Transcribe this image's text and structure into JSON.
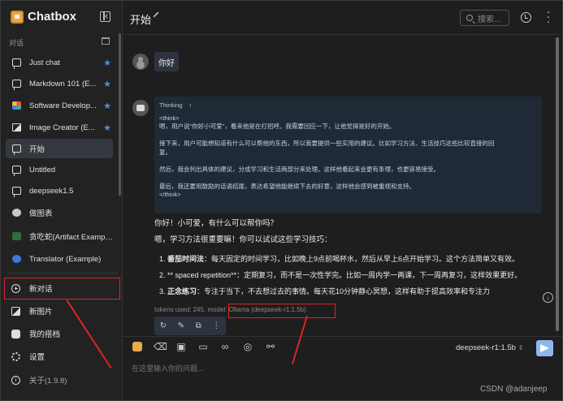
{
  "app": {
    "name": "Chatbox"
  },
  "sidebar": {
    "section_label": "对话",
    "items": [
      {
        "label": "Just chat",
        "icon": "chat-icon",
        "starred": true
      },
      {
        "label": "Markdown 101 (E...",
        "icon": "chat-icon",
        "starred": true
      },
      {
        "label": "Software Develop...",
        "icon": "software-avatar-icon",
        "starred": true
      },
      {
        "label": "Image Creator (E...",
        "icon": "image-icon",
        "starred": true
      },
      {
        "label": "开始",
        "icon": "chat-icon",
        "starred": false,
        "active": true
      },
      {
        "label": "Untitled",
        "icon": "chat-icon",
        "starred": false
      },
      {
        "label": "deepseek1.5",
        "icon": "chat-icon",
        "starred": false
      },
      {
        "label": "做图表",
        "icon": "chart-avatar-icon",
        "starred": false
      },
      {
        "label": "贪吃蛇(Artifact Example)",
        "icon": "snake-avatar-icon",
        "starred": false
      },
      {
        "label": "Translator (Example)",
        "icon": "translator-avatar-icon",
        "starred": false
      }
    ],
    "new_chat": "新对话",
    "new_image": "新图片",
    "my_copilots": "我的搭档",
    "settings": "设置",
    "about": "关于(1.9.8)"
  },
  "header": {
    "title": "开始",
    "search_placeholder": "搜索..."
  },
  "conversation": {
    "user_message": "你好",
    "thinking_label": "Thinking",
    "thinking_lines": [
      "<think>",
      "嗯，用户说\"你好小可爱\"，看来他是在打招呼。我需要回应一下，让他觉得是好的开始。",
      "",
      "接下来，用户可能想知道有什么可以帮他的东西，所以我要提供一些实用的建议。比如学习方法、生活技巧这些比较直接的回",
      "复。",
      "",
      "然后，我会列出具体的建议，分成学习和生活两部分来处理。这样他看起来会更有条理，也更容易接受。",
      "",
      "最后，我还要用鼓励的话语结尾，表达希望他能继续下去的好意，这样他会感到被重视和支持。",
      "</think>"
    ],
    "answer_line1": "你好！小可爱，有什么可以帮你吗？",
    "answer_line2": "嗯，学习方法很重要嘛！你可以试试这些学习技巧：",
    "tips": [
      {
        "num": "1.",
        "title": "番茄时间法",
        "text": "：每天固定的时间学习，比如晚上9点前喝杯水，然后从早上6点开始学习。这个方法简单又有效。"
      },
      {
        "num": "2.",
        "title": "",
        "text": "** spaced repetition**：定期复习，而不是一次性学完。比如一周内学一两课，下一周再复习，这样效果更好。"
      },
      {
        "num": "3.",
        "title": "正念练习",
        "text": "：专注于当下，不去想过去的事情。每天花10分钟静心冥想，这样有助于提高效率和专注力"
      }
    ],
    "tokens_prefix": "tokens used: 245, model:",
    "model_used": "Ollama (deepseek-r1:1.5b)"
  },
  "input": {
    "model": "deepseek-r1:1.5b",
    "placeholder": "在这里输入你的问题..."
  },
  "watermark": "CSDN @adanjeep",
  "colors": {
    "accent": "#4f8fdf",
    "annotation": "#d8262b",
    "send": "#8fb8ea"
  }
}
